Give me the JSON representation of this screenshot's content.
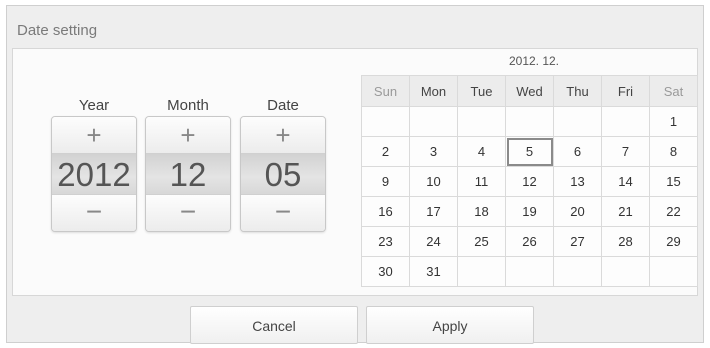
{
  "window": {
    "title": "Date setting"
  },
  "spinners": {
    "year": {
      "label": "Year",
      "value": "2012",
      "plus": "+",
      "minus": "−"
    },
    "month": {
      "label": "Month",
      "value": "12",
      "plus": "+",
      "minus": "−"
    },
    "date": {
      "label": "Date",
      "value": "05",
      "plus": "+",
      "minus": "−"
    }
  },
  "calendar": {
    "month_label": "2012. 12.",
    "weekdays": [
      "Sun",
      "Mon",
      "Tue",
      "Wed",
      "Thu",
      "Fri",
      "Sat"
    ],
    "weeks": [
      [
        "",
        "",
        "",
        "",
        "",
        "",
        "1"
      ],
      [
        "2",
        "3",
        "4",
        "5",
        "6",
        "7",
        "8"
      ],
      [
        "9",
        "10",
        "11",
        "12",
        "13",
        "14",
        "15"
      ],
      [
        "16",
        "17",
        "18",
        "19",
        "20",
        "21",
        "22"
      ],
      [
        "23",
        "24",
        "25",
        "26",
        "27",
        "28",
        "29"
      ],
      [
        "30",
        "31",
        "",
        "",
        "",
        "",
        ""
      ]
    ],
    "selected_day": "5"
  },
  "buttons": {
    "cancel": "Cancel",
    "apply": "Apply"
  },
  "colors": {
    "background": "#eeeeee",
    "panel": "#fbfbfb",
    "selected_border": "#8a8a8a"
  }
}
